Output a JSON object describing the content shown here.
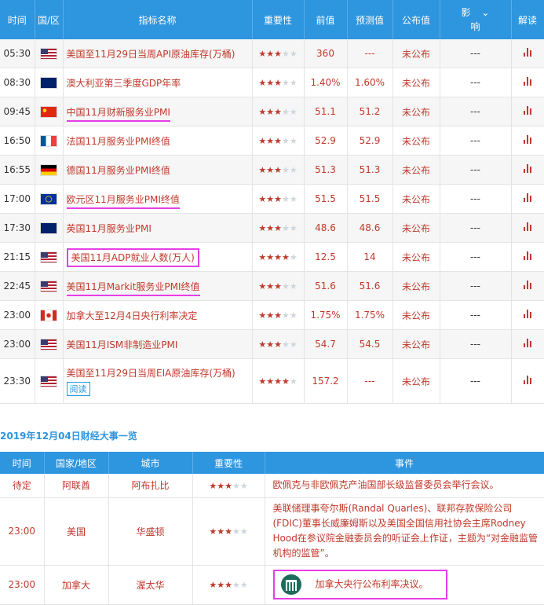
{
  "main_table": {
    "headers": {
      "time": "时间",
      "region": "国/区",
      "indicator": "指标名称",
      "importance": "重要性",
      "prev": "前值",
      "forecast": "预测值",
      "actual": "公布值",
      "impact_1": "影",
      "impact_2": "响",
      "interpret": "解读"
    },
    "rows": [
      {
        "time": "05:30",
        "flag": "us",
        "name": "美国至11月29日当周API原油库存(万桶)",
        "stars": 3,
        "prev": "360",
        "forecast": "---",
        "actual": "未公布",
        "impact": "---"
      },
      {
        "time": "08:30",
        "flag": "au",
        "name": "澳大利亚第三季度GDP年率",
        "stars": 3,
        "prev": "1.40%",
        "forecast": "1.60%",
        "actual": "未公布",
        "impact": "---"
      },
      {
        "time": "09:45",
        "flag": "cn",
        "name": "中国11月财新服务业PMI",
        "stars": 3,
        "prev": "51.1",
        "forecast": "51.2",
        "actual": "未公布",
        "impact": "---"
      },
      {
        "time": "16:50",
        "flag": "fr",
        "name": "法国11月服务业PMI终值",
        "stars": 3,
        "prev": "52.9",
        "forecast": "52.9",
        "actual": "未公布",
        "impact": "---"
      },
      {
        "time": "16:55",
        "flag": "de",
        "name": "德国11月服务业PMI终值",
        "stars": 3,
        "prev": "51.3",
        "forecast": "51.3",
        "actual": "未公布",
        "impact": "---"
      },
      {
        "time": "17:00",
        "flag": "eu",
        "name": "欧元区11月服务业PMI终值",
        "stars": 3,
        "prev": "51.5",
        "forecast": "51.5",
        "actual": "未公布",
        "impact": "---"
      },
      {
        "time": "17:30",
        "flag": "gb",
        "name": "英国11月服务业PMI",
        "stars": 3,
        "prev": "48.6",
        "forecast": "48.6",
        "actual": "未公布",
        "impact": "---"
      },
      {
        "time": "21:15",
        "flag": "us",
        "name": "美国11月ADP就业人数(万人)",
        "stars": 4,
        "prev": "12.5",
        "forecast": "14",
        "actual": "未公布",
        "impact": "---"
      },
      {
        "time": "22:45",
        "flag": "us",
        "name": "美国11月Markit服务业PMI终值",
        "stars": 3,
        "prev": "51.6",
        "forecast": "51.6",
        "actual": "未公布",
        "impact": "---"
      },
      {
        "time": "23:00",
        "flag": "ca",
        "name": "加拿大至12月4日央行利率决定",
        "stars": 3,
        "prev": "1.75%",
        "forecast": "1.75%",
        "actual": "未公布",
        "impact": "---"
      },
      {
        "time": "23:00",
        "flag": "us",
        "name": "美国11月ISM非制造业PMI",
        "stars": 3,
        "prev": "54.7",
        "forecast": "54.5",
        "actual": "未公布",
        "impact": "---"
      },
      {
        "time": "23:30",
        "flag": "us",
        "name": "美国至11月29日当周EIA原油库存(万桶)",
        "stars": 4,
        "prev": "157.2",
        "forecast": "---",
        "actual": "未公布",
        "impact": "---",
        "read_label": "阅读"
      }
    ]
  },
  "events_section": {
    "title": "2019年12月04日财经大事一览",
    "headers": {
      "time": "时间",
      "country": "国家/地区",
      "city": "城市",
      "importance": "重要性",
      "event": "事件"
    },
    "rows": [
      {
        "time": "待定",
        "country": "阿联酋",
        "city": "阿布扎比",
        "stars": 3,
        "event": "欧佩克与非欧佩克产油国部长级监督委员会举行会议。"
      },
      {
        "time": "23:00",
        "country": "美国",
        "city": "华盛顿",
        "stars": 3,
        "event": "美联储理事夸尔斯(Randal Quarles)、联邦存款保险公司(FDIC)董事长威廉姆斯以及美国全国信用社协会主席Rodney Hood在参议院金融委员会的听证会上作证，主题为“对金融监管机构的监管”。"
      },
      {
        "time": "23:00",
        "country": "加拿大",
        "city": "渥太华",
        "stars": 3,
        "event": "加拿大央行公布利率决议。"
      }
    ]
  },
  "colors": {
    "header_bg": "#2e95df",
    "accent_red": "#c0392b",
    "highlight": "#e63ee6"
  }
}
